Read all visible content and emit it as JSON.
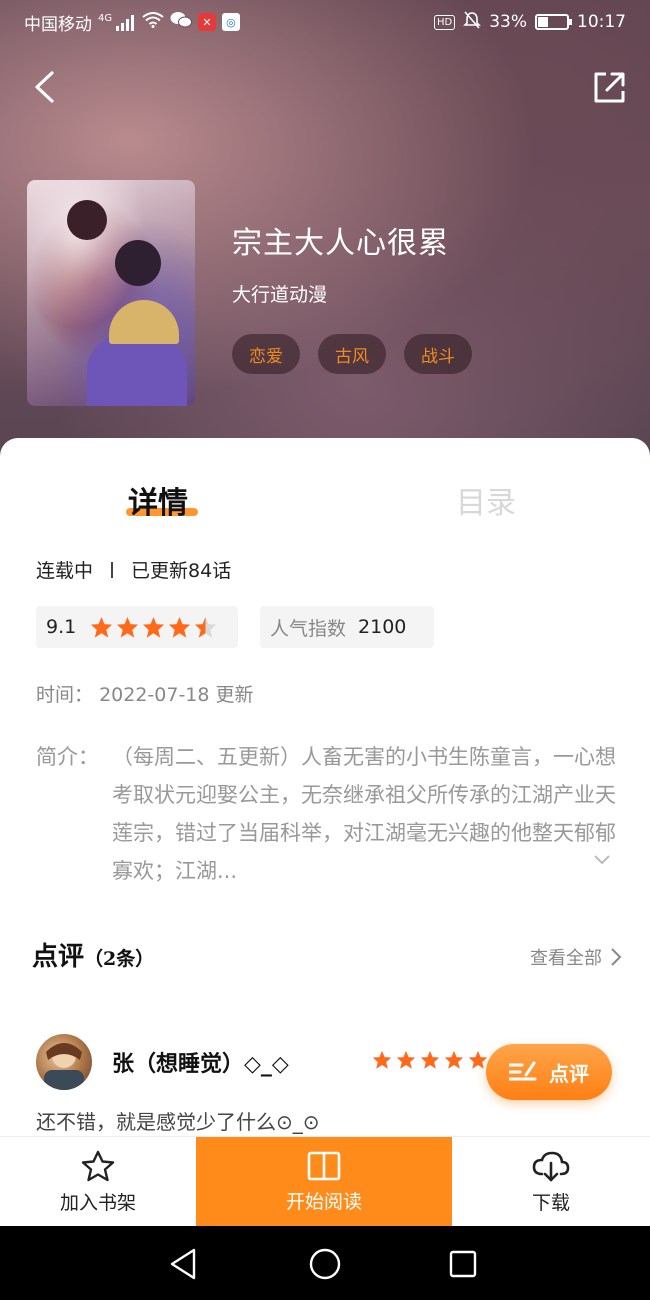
{
  "status_bar": {
    "carrier": "中国移动",
    "network": "4G",
    "battery_text": "33%",
    "battery_level": 0.33,
    "time": "10:17",
    "hd_label": "HD"
  },
  "book": {
    "title": "宗主大人心很累",
    "author": "大行道动漫",
    "tags": [
      "恋爱",
      "古风",
      "战斗"
    ]
  },
  "tabs": {
    "detail": "详情",
    "catalog": "目录"
  },
  "status": {
    "state": "连载中",
    "updated": "已更新84话"
  },
  "rating": {
    "score": "9.1",
    "stars": 4.5
  },
  "popularity": {
    "label": "人气指数",
    "value": "2100"
  },
  "time": {
    "label": "时间：",
    "value": "2022-07-18 更新"
  },
  "intro": {
    "label": "简介：",
    "text": "（每周二、五更新）人畜无害的小书生陈童言，一心想考取状元迎娶公主，无奈继承祖父所传承的江湖产业天莲宗，错过了当届科举，对江湖毫无兴趣的他整天郁郁寡欢；江湖..."
  },
  "reviews": {
    "title": "点评",
    "count": "（2条）",
    "see_all": "查看全部",
    "items": [
      {
        "user": "张（想睡觉）◇_◇",
        "stars": 5,
        "text": "还不错，就是感觉少了什么⊙_⊙"
      }
    ],
    "comment_button": "点评"
  },
  "actions": {
    "shelf": "加入书架",
    "read": "开始阅读",
    "download": "下载"
  },
  "colors": {
    "accent": "#ff8c1a",
    "tag_text": "#f08a24"
  }
}
